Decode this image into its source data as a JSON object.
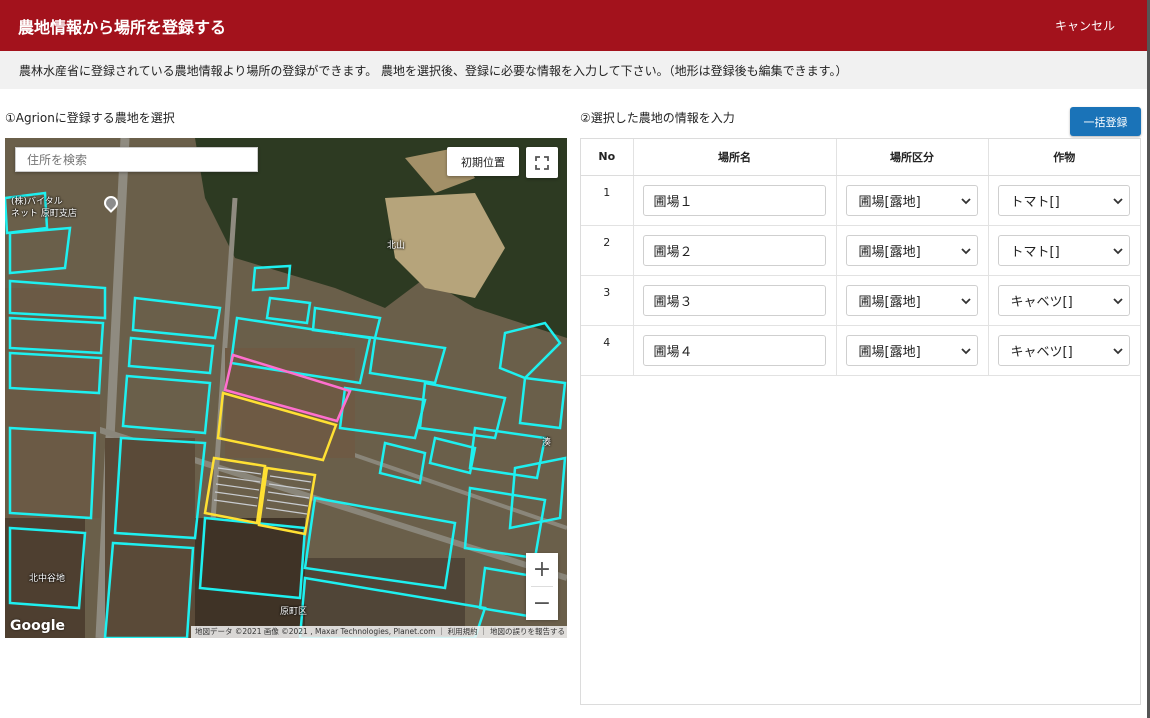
{
  "header": {
    "title": "農地情報から場所を登録する",
    "cancel_label": "キャンセル"
  },
  "notice": "農林水産省に登録されている農地情報より場所の登録ができます。 農地を選択後、登録に必要な情報を入力して下さい。（地形は登録後も編集できます。）",
  "left_section": {
    "label": "①Agrionに登録する農地を選択",
    "search_placeholder": "住所を検索",
    "init_position_label": "初期位置",
    "zoom_in_label": "+",
    "zoom_out_label": "−",
    "map_labels": {
      "shop": "(株)バイタル\nネット 原町支店",
      "kitayama": "北山",
      "kitanakahara": "北中谷地",
      "haramachi": "原町区",
      "mina": "湊"
    },
    "google_logo": "Google",
    "attribution": "地図データ ©2021 画像 ©2021 , Maxar Technologies, Planet.com ｜ 利用規約 ｜ 地図の誤りを報告する"
  },
  "right_section": {
    "label": "②選択した農地の情報を入力",
    "bulk_register_label": "一括登録",
    "columns": [
      "No",
      "場所名",
      "場所区分",
      "作物"
    ],
    "rows": [
      {
        "no": "1",
        "name": "圃場１",
        "division": "圃場[露地]",
        "crop": "トマト[]"
      },
      {
        "no": "2",
        "name": "圃場２",
        "division": "圃場[露地]",
        "crop": "トマト[]"
      },
      {
        "no": "3",
        "name": "圃場３",
        "division": "圃場[露地]",
        "crop": "キャベツ[]"
      },
      {
        "no": "4",
        "name": "圃場４",
        "division": "圃場[露地]",
        "crop": "キャベツ[]"
      }
    ]
  },
  "colors": {
    "header": "#a3121c",
    "accent_button": "#1a73b8",
    "field_outline": "#1ef0f0",
    "selected_yellow": "#ffe033",
    "selected_pink": "#ff6fcf"
  },
  "icons": [
    "fullscreen-icon",
    "chevron-down-icon",
    "map-pin-icon"
  ]
}
